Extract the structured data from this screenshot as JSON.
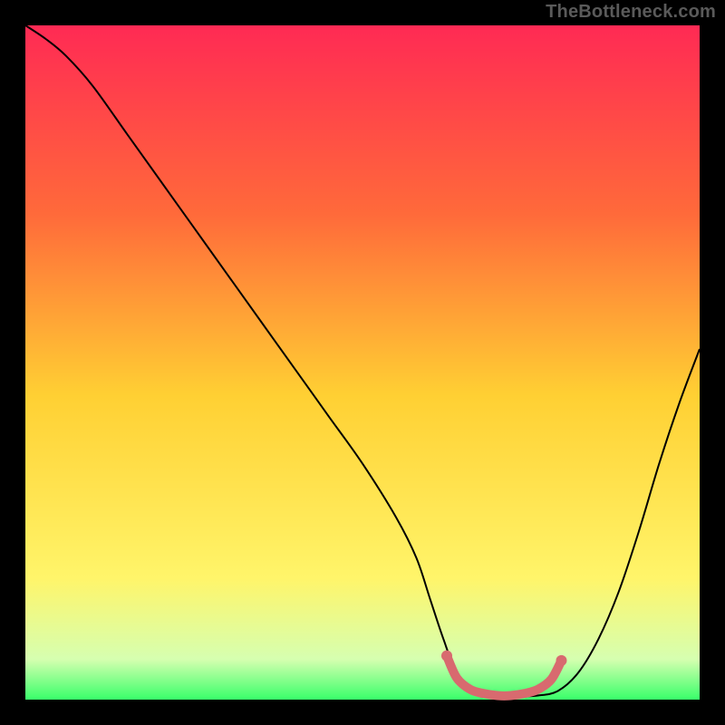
{
  "watermark": "TheBottleneck.com",
  "chart_data": {
    "type": "line",
    "title": "",
    "xlabel": "",
    "ylabel": "",
    "xlim": [
      0,
      100
    ],
    "ylim": [
      0,
      100
    ],
    "grid": false,
    "legend": false,
    "background_gradient": {
      "top": "#ff2a54",
      "mid_upper": "#ff6a3a",
      "mid": "#ffd033",
      "mid_lower": "#fff56a",
      "bottom": "#39ff6a"
    },
    "series": [
      {
        "name": "bottleneck-curve",
        "color": "#000000",
        "stroke_width": 2,
        "x": [
          0,
          3,
          6,
          10,
          15,
          20,
          25,
          30,
          35,
          40,
          45,
          50,
          55,
          58,
          60,
          62,
          64,
          67,
          70,
          73,
          76,
          79,
          82,
          85,
          88,
          91,
          94,
          97,
          100
        ],
        "y": [
          100,
          98,
          95.5,
          91,
          84,
          77,
          70,
          63,
          56,
          49,
          42,
          35,
          27,
          21,
          15,
          9,
          4,
          1.2,
          0.6,
          0.5,
          0.6,
          1.3,
          4,
          9,
          16,
          25,
          35,
          44,
          52
        ]
      },
      {
        "name": "fit-region-marker",
        "color": "#d86a6f",
        "stroke_width": 10,
        "linecap": "round",
        "x": [
          62.5,
          64,
          66,
          68,
          70,
          72,
          74,
          76,
          78,
          79.5
        ],
        "y": [
          6.5,
          3.2,
          1.5,
          0.9,
          0.6,
          0.6,
          0.9,
          1.5,
          3.0,
          5.8
        ],
        "end_dots": true
      }
    ]
  }
}
